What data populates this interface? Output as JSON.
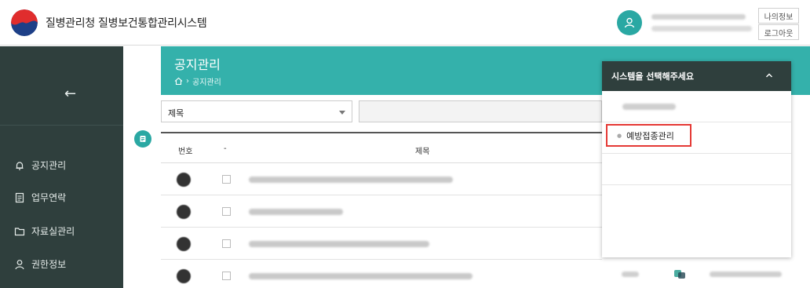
{
  "header": {
    "app_title": "질병관리청 질병보건통합관리시스템",
    "my_info_label": "나의정보",
    "logout_label": "로그아웃"
  },
  "sidebar": {
    "items": [
      {
        "label": "공지관리",
        "icon": "bell-icon"
      },
      {
        "label": "업무연락",
        "icon": "document-icon"
      },
      {
        "label": "자료실관리",
        "icon": "folder-icon"
      },
      {
        "label": "권한정보",
        "icon": "person-icon"
      }
    ]
  },
  "page": {
    "title": "공지관리",
    "breadcrumb": "공지관리"
  },
  "filter": {
    "select_value": "제목"
  },
  "table": {
    "headers": {
      "number": "번호",
      "mark": "-",
      "title": "제목"
    }
  },
  "dropdown": {
    "header": "시스템을 선택해주세요",
    "selected_item": "예방접종관리"
  },
  "colors": {
    "teal": "#34b1ab",
    "sidebar": "#2f3f3d",
    "highlight": "#e53935"
  }
}
